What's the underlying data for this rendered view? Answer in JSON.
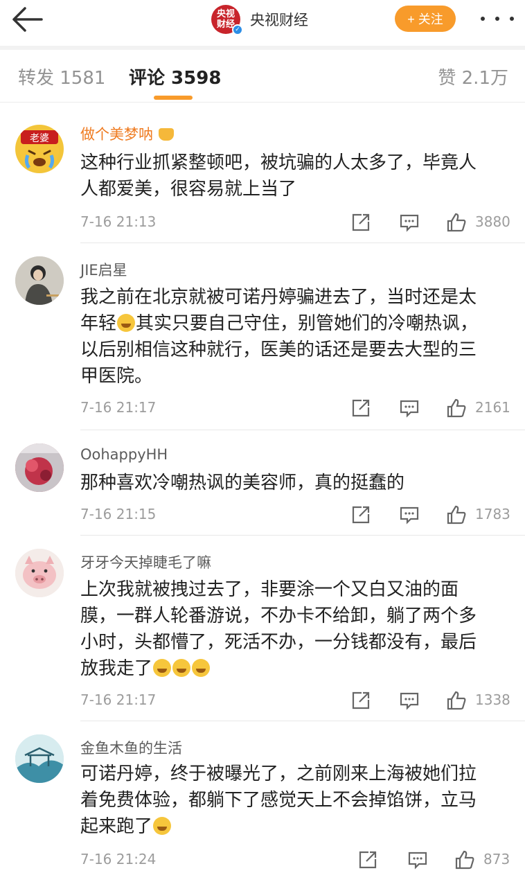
{
  "header": {
    "account_name": "央视财经",
    "logo_text_top": "央视",
    "logo_text_bottom": "财经",
    "follow_label": "+ 关注",
    "icons": [
      "back-arrow-icon",
      "verified-icon",
      "more-icon"
    ]
  },
  "tabs": {
    "repost": "转发 1581",
    "comment": "评论 3598",
    "like": "赞 2.1万",
    "accent_color": "#f89b2b"
  },
  "comments": [
    {
      "user": "做个美梦呐",
      "avatar_text": "老婆",
      "text_lines": [
        "这种行业抓紧整顿吧，被坑骗的人太多了，毕竟人",
        "人都爱美，很容易就上当了"
      ],
      "time": "7-16 21:13",
      "likes": "3880"
    },
    {
      "user": "JIE启星",
      "text_lines": [
        "我之前在北京就被可诺丹婷骗进去了，当时还是太",
        "年轻",
        "其实只要自己守住，别管她们的冷嘲热讽，",
        "以后别相信这种就行，医美的话还是要去大型的三",
        "甲医院。"
      ],
      "time": "7-16 21:17",
      "likes": "2161"
    },
    {
      "user": "OohappyHH",
      "text_lines": [
        "那种喜欢冷嘲热讽的美容师，真的挺蠢的"
      ],
      "time": "7-16 21:15",
      "likes": "1783"
    },
    {
      "user": "牙牙今天掉睫毛了嘛",
      "text_lines": [
        "上次我就被拽过去了，非要涂一个又白又油的面",
        "膜，一群人轮番游说，不办卡不给卸，躺了两个多",
        "小时，头都懵了，死活不办，一分钱都没有，最后",
        "放我走了"
      ],
      "time": "7-16 21:17",
      "likes": "1338"
    },
    {
      "user": "金鱼木鱼的生活",
      "text_lines": [
        "可诺丹婷，终于被曝光了，之前刚来上海被她们拉",
        "着免费体验，都躺下了感觉天上不会掉馅饼，立马",
        "起来跑了"
      ],
      "time": "7-16 21:24",
      "likes": "873"
    }
  ]
}
